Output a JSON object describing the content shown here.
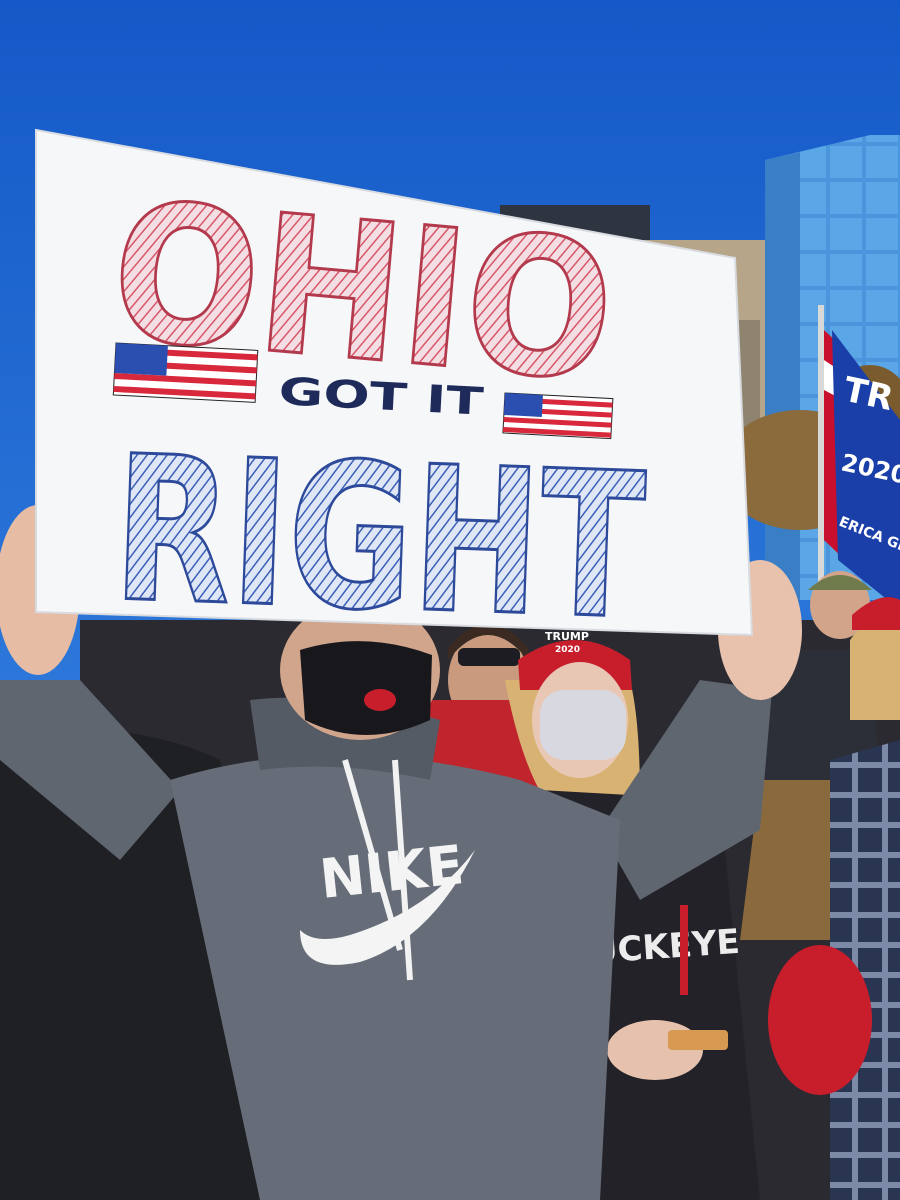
{
  "sign": {
    "line1": "OHIO",
    "line2": "GOT IT",
    "line3": "RIGHT"
  },
  "apparel": {
    "hoodie_brand": "NIKE",
    "shirt_text": "BUCKEYE",
    "hat_text": "TRUMP",
    "hat_year": "2020"
  },
  "flag": {
    "text_tr": "TR",
    "year": "2020",
    "slogan": "ERICA GREA"
  },
  "colors": {
    "sky": "#1e6fd8",
    "sign_board": "#f6f7f9",
    "sign_red": "#d8566a",
    "sign_blue": "#3b5fb8",
    "hoodie": "#5f6670",
    "building_glass": "#3f8fd8"
  }
}
